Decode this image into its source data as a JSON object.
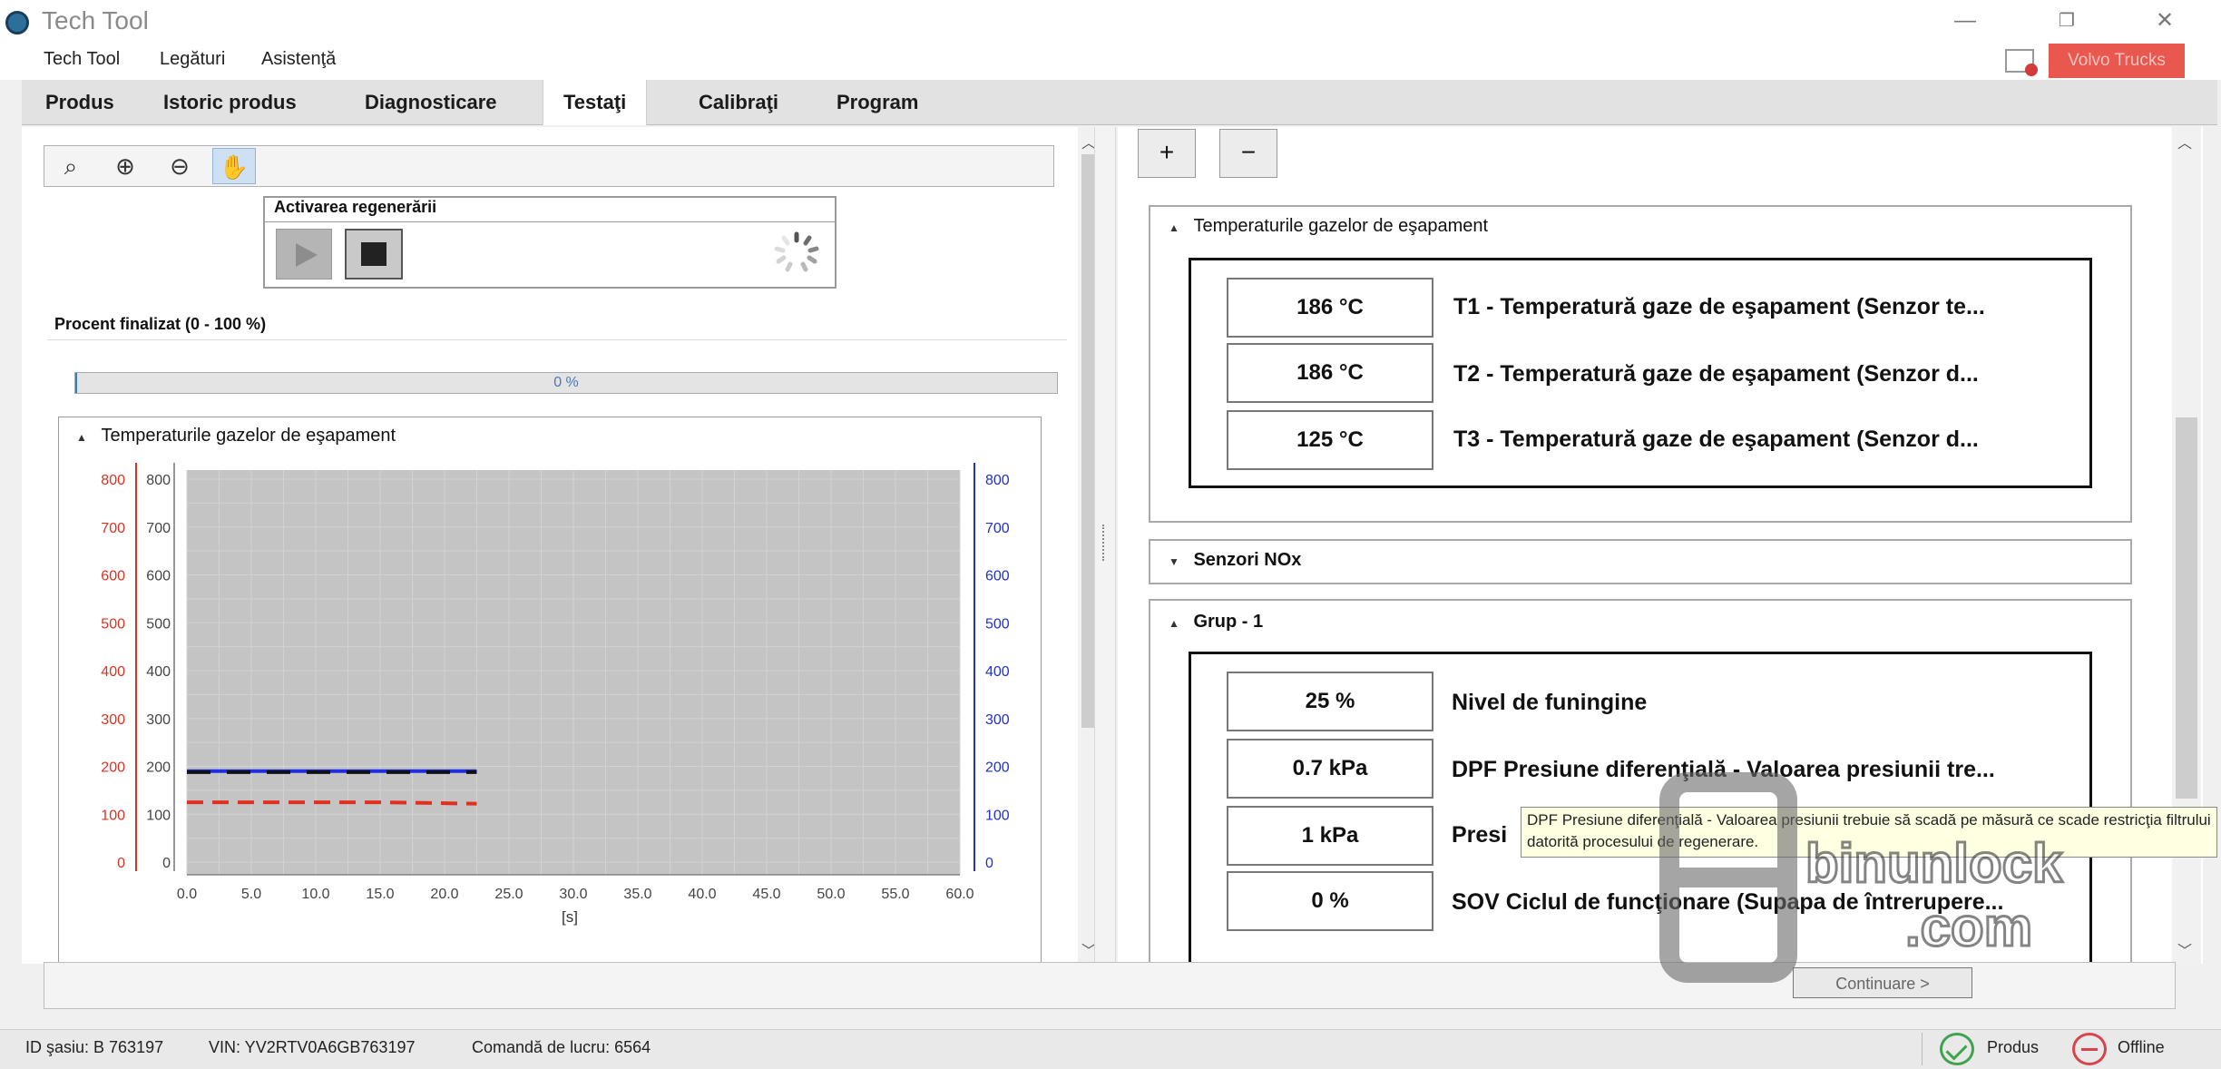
{
  "window": {
    "title": "Tech Tool",
    "controls": {
      "minimize": "—",
      "maximize": "❐",
      "close": "✕"
    }
  },
  "menu": {
    "items": [
      "Tech Tool",
      "Legături",
      "Asistenţă"
    ],
    "brand": "Volvo Trucks"
  },
  "tabs": [
    {
      "label": "Produs",
      "active": false
    },
    {
      "label": "Istoric produs",
      "active": false
    },
    {
      "label": "Diagnosticare",
      "active": false
    },
    {
      "label": "Testaţi",
      "active": true
    },
    {
      "label": "Calibraţi",
      "active": false
    },
    {
      "label": "Program",
      "active": false
    }
  ],
  "toolbar": {
    "icons": [
      "zoom-fit-icon",
      "zoom-in-icon",
      "zoom-out-icon",
      "hand-pan-icon"
    ],
    "glyphs": [
      "⌕",
      "⊕",
      "⊖",
      "✋"
    ]
  },
  "regeneration": {
    "title": "Activarea regenerării"
  },
  "progress": {
    "label": "Procent finalizat (0 - 100 %)",
    "value_text": "0 %",
    "fraction": 0.0
  },
  "chart_panel": {
    "title": "Temperaturile gazelor de eşapament",
    "caret": "▲"
  },
  "chart_data": {
    "type": "line",
    "x": [
      0,
      2.5,
      5,
      7.5,
      10,
      12.5,
      15,
      17.5,
      20,
      22.5
    ],
    "series": [
      {
        "values": [
          190,
          190,
          190,
          190,
          190,
          190,
          190,
          190,
          190,
          190
        ],
        "color": "#1f2ee0",
        "style": "solid"
      },
      {
        "values": [
          188,
          188,
          188,
          188,
          188,
          188,
          188,
          188,
          188,
          188
        ],
        "color": "#111111",
        "style": "dashed"
      },
      {
        "values": [
          125,
          125,
          125,
          125,
          125,
          125,
          125,
          124,
          123,
          122
        ],
        "color": "#e03020",
        "style": "dashed"
      }
    ],
    "xlabel": "[s]",
    "xlim": [
      0,
      60
    ],
    "ylim": [
      0,
      800
    ],
    "x_ticks": [
      "0.0",
      "5.0",
      "10.0",
      "15.0",
      "20.0",
      "25.0",
      "30.0",
      "35.0",
      "40.0",
      "45.0",
      "50.0",
      "55.0",
      "60.0"
    ],
    "y_ticks": [
      "0",
      "100",
      "200",
      "300",
      "400",
      "500",
      "600",
      "700",
      "800"
    ],
    "axis_colors": {
      "left_outer": "#e03020",
      "left_inner": "#333333",
      "right": "#2030d0"
    },
    "grid": true
  },
  "zoom_buttons": {
    "expand": "+",
    "collapse": "−"
  },
  "sections": [
    {
      "title": "Temperaturile gazelor de eşapament",
      "caret": "▲",
      "rows": [
        {
          "value": "186 °C",
          "label": "T1 - Temperatură gaze de eşapament (Senzor te..."
        },
        {
          "value": "186 °C",
          "label": "T2 - Temperatură gaze de eşapament (Senzor d..."
        },
        {
          "value": "125 °C",
          "label": "T3 - Temperatură gaze de eşapament (Senzor d..."
        }
      ]
    },
    {
      "title": "Senzori NOx",
      "caret": "▼"
    },
    {
      "title": "Grup - 1",
      "caret": "▲",
      "rows": [
        {
          "value": "25 %",
          "label": "Nivel de funingine"
        },
        {
          "value": "0.7 kPa",
          "label": "DPF Presiune diferenţială - Valoarea presiunii tre..."
        },
        {
          "value": "1 kPa",
          "label": "Presi"
        },
        {
          "value": "0 %",
          "label": "SOV Ciclul de funcţionare (Supapa de întrerupere..."
        }
      ]
    }
  ],
  "tooltip": {
    "text": "DPF Presiune diferenţială - Valoarea presiunii trebuie să scadă pe măsură ce scade restricţia filtrului datorită procesului de regenerare."
  },
  "continue_button": "Continuare >",
  "status": {
    "id": "ID şasiu: B 763197",
    "vin": "VIN: YV2RTV0A6GB763197",
    "work_order": "Comandă de lucru: 6564",
    "product": "Produs",
    "connection": "Offline"
  },
  "watermark": {
    "text": "binunlock",
    "subtext": ".com"
  }
}
